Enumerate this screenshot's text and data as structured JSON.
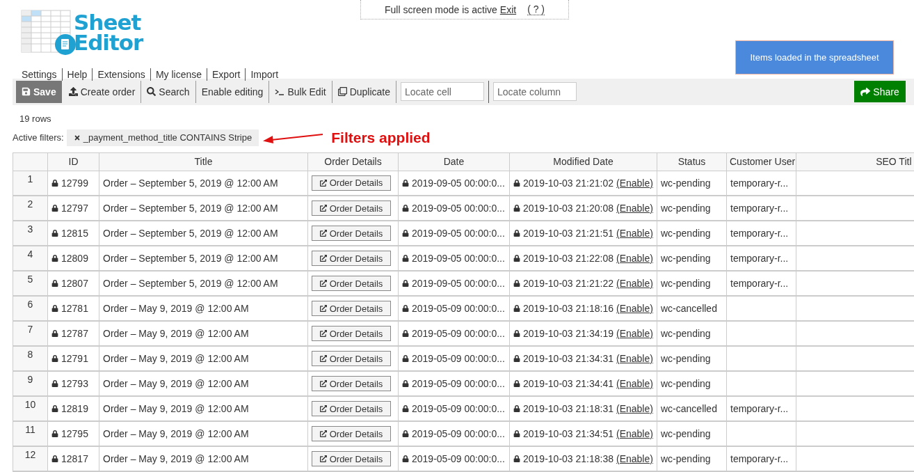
{
  "fullscreen_notice": {
    "text": "Full screen mode is active",
    "exit_link": "Exit",
    "help_link": "( ? )"
  },
  "logo": {
    "line_1": "Sheet",
    "line_2": "Editor"
  },
  "loaded_banner": "Items loaded in the spreadsheet",
  "menu": [
    "Settings",
    "Help",
    "Extensions",
    "My license",
    "Export",
    "Import"
  ],
  "toolbar": {
    "buttons": [
      {
        "kind": "save",
        "label": "Save"
      },
      {
        "kind": "upload",
        "label": "Create order"
      },
      {
        "kind": "search",
        "label": "Search"
      },
      {
        "kind": "plain",
        "label": "Enable editing"
      },
      {
        "kind": "terminal",
        "label": "Bulk Edit"
      },
      {
        "kind": "duplicate",
        "label": "Duplicate"
      }
    ],
    "locate_cell": {
      "placeholder": "Locate cell"
    },
    "locate_column": {
      "placeholder": "Locate column"
    },
    "share": "Share"
  },
  "row_count": "19 rows",
  "filters": {
    "label": "Active filters:",
    "items": [
      "_payment_method_title CONTAINS Stripe"
    ]
  },
  "annotation": "Filters applied",
  "table": {
    "columns": [
      "ID",
      "Title",
      "Order Details",
      "Date",
      "Modified Date",
      "Status",
      "Customer User",
      "SEO Titl"
    ],
    "rows": [
      {
        "num": "1",
        "id": "12799",
        "title": "Order – September 5, 2019 @ 12:00 AM",
        "details": "Order Details",
        "date": "2019-09-05 00:00:0...",
        "modified": "2019-10-03 21:21:02",
        "enable": "(Enable)",
        "status": "wc-pending",
        "customer": "temporary-r..."
      },
      {
        "num": "2",
        "id": "12797",
        "title": "Order – September 5, 2019 @ 12:00 AM",
        "details": "Order Details",
        "date": "2019-09-05 00:00:0...",
        "modified": "2019-10-03 21:20:08",
        "enable": "(Enable)",
        "status": "wc-pending",
        "customer": "temporary-r..."
      },
      {
        "num": "3",
        "id": "12815",
        "title": "Order – September 5, 2019 @ 12:00 AM",
        "details": "Order Details",
        "date": "2019-09-05 00:00:0...",
        "modified": "2019-10-03 21:21:51",
        "enable": "(Enable)",
        "status": "wc-pending",
        "customer": "temporary-r..."
      },
      {
        "num": "4",
        "id": "12809",
        "title": "Order – September 5, 2019 @ 12:00 AM",
        "details": "Order Details",
        "date": "2019-09-05 00:00:0...",
        "modified": "2019-10-03 21:22:08",
        "enable": "(Enable)",
        "status": "wc-pending",
        "customer": "temporary-r..."
      },
      {
        "num": "5",
        "id": "12807",
        "title": "Order – September 5, 2019 @ 12:00 AM",
        "details": "Order Details",
        "date": "2019-09-05 00:00:0...",
        "modified": "2019-10-03 21:21:22",
        "enable": "(Enable)",
        "status": "wc-pending",
        "customer": "temporary-r..."
      },
      {
        "num": "6",
        "id": "12781",
        "title": "Order – May 9, 2019 @ 12:00 AM",
        "details": "Order Details",
        "date": "2019-05-09 00:00:0...",
        "modified": "2019-10-03 21:18:16",
        "enable": "(Enable)",
        "status": "wc-cancelled"
      },
      {
        "num": "7",
        "id": "12787",
        "title": "Order – May 9, 2019 @ 12:00 AM",
        "details": "Order Details",
        "date": "2019-05-09 00:00:0...",
        "modified": "2019-10-03 21:34:19",
        "enable": "(Enable)",
        "status": "wc-pending"
      },
      {
        "num": "8",
        "id": "12791",
        "title": "Order – May 9, 2019 @ 12:00 AM",
        "details": "Order Details",
        "date": "2019-05-09 00:00:0...",
        "modified": "2019-10-03 21:34:31",
        "enable": "(Enable)",
        "status": "wc-pending"
      },
      {
        "num": "9",
        "id": "12793",
        "title": "Order – May 9, 2019 @ 12:00 AM",
        "details": "Order Details",
        "date": "2019-05-09 00:00:0...",
        "modified": "2019-10-03 21:34:41",
        "enable": "(Enable)",
        "status": "wc-pending"
      },
      {
        "num": "10",
        "id": "12819",
        "title": "Order – May 9, 2019 @ 12:00 AM",
        "details": "Order Details",
        "date": "2019-05-09 00:00:0...",
        "modified": "2019-10-03 21:18:31",
        "enable": "(Enable)",
        "status": "wc-cancelled",
        "customer": "temporary-r..."
      },
      {
        "num": "11",
        "id": "12795",
        "title": "Order – May 9, 2019 @ 12:00 AM",
        "details": "Order Details",
        "date": "2019-05-09 00:00:0...",
        "modified": "2019-10-03 21:34:51",
        "enable": "(Enable)",
        "status": "wc-pending"
      },
      {
        "num": "12",
        "id": "12817",
        "title": "Order – May 9, 2019 @ 12:00 AM",
        "details": "Order Details",
        "date": "2019-05-09 00:00:0...",
        "modified": "2019-10-03 21:18:38",
        "enable": "(Enable)",
        "status": "wc-pending",
        "customer": "temporary-r..."
      }
    ]
  }
}
